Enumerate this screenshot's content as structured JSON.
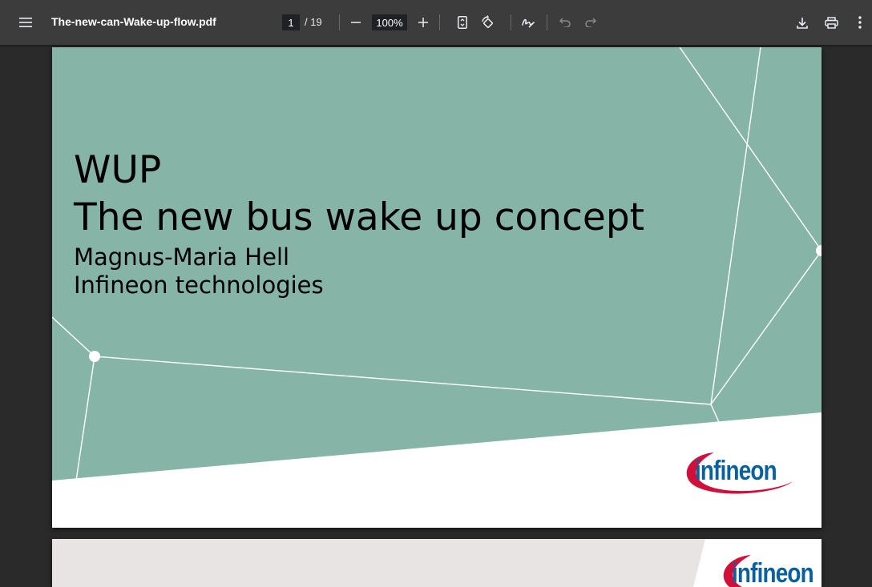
{
  "toolbar": {
    "menu_icon": "hamburger-menu-icon",
    "title": "The-new-can-Wake-up-flow.pdf",
    "page_current": "1",
    "page_total": "/ 19",
    "zoom": "100%",
    "icons": [
      "zoom-out-icon",
      "zoom-in-icon",
      "fit-page-icon",
      "rotate-icon",
      "annotate-icon",
      "undo-icon",
      "redo-icon",
      "download-icon",
      "print-icon",
      "more-options-icon"
    ]
  },
  "slide1": {
    "title_line1": "WUP",
    "title_line2": "The new bus wake up concept",
    "author": "Magnus-Maria Hell",
    "company": "Infineon technologies",
    "logo_text": "infineon"
  },
  "slide2": {
    "logo_text": "infineon"
  },
  "colors": {
    "toolbar_bg": "#3c3c3c",
    "viewer_bg": "#2a2a2a",
    "slide_green": "#86b4a6",
    "logo_blue": "#0a5f9e",
    "logo_red": "#d0103a",
    "slide2_bg": "#e8e4e4"
  }
}
